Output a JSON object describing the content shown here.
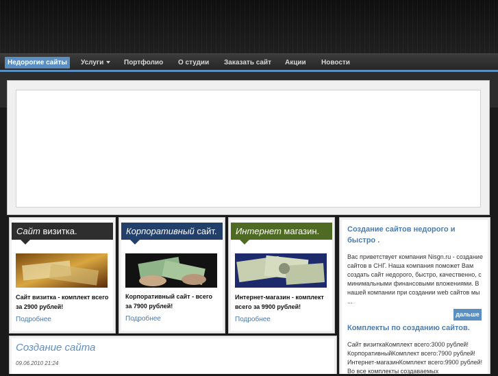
{
  "nav": {
    "items": [
      {
        "label": "Недорогие сайты",
        "active": true
      },
      {
        "label": "Услуги",
        "dropdown": true
      },
      {
        "label": "Портфолио"
      },
      {
        "label": "О студии"
      },
      {
        "label": "Заказать сайт"
      },
      {
        "label": "Акции"
      },
      {
        "label": "Новости"
      }
    ]
  },
  "products": [
    {
      "title_em": "Сайт",
      "title_rest": " визитка.",
      "head_color": "#2e2e2e",
      "text": "Сайт визитка - комплект всего за 2900 рублей!",
      "more": "Подробнее"
    },
    {
      "title_em": "Корпоративный",
      "title_rest": " сайт.",
      "head_color": "#23406b",
      "text": "Корпоративный сайт - всего за 7900 рублей!",
      "more": "Подробнее"
    },
    {
      "title_em": "Интернет",
      "title_rest": " магазин.",
      "head_color": "#4f6a23",
      "text": "Интернет-магазин - комплект всего за 9900 рублей!",
      "more": "Подробнее"
    }
  ],
  "sidebar": {
    "title": "Создание сайтов недорого и быстро .",
    "intro": "Вас приветствует компания Nisgn.ru - создание сайтов в СНГ. Наша компания поможет Вам создать сайт недорого, быстро, качественно, с минимальными финансовыми вложениями. В нашей компании при создании web сайтов мы ...",
    "more_button": "дальше",
    "section2_title": "Комплекты по созданию сайтов.",
    "section2_text": "Сайт визиткаКомплект всего:3000 рублей! КорпоративныйКомплект всего:7900 рублей! Интернет-магазинКомплект всего:9900 рублей! Во все комплекты создаваемых"
  },
  "article": {
    "title": "Создание сайта",
    "date": "09.06.2010 21:24"
  },
  "colors": {
    "accent": "#5b8fc2",
    "link": "#4a78a8"
  }
}
